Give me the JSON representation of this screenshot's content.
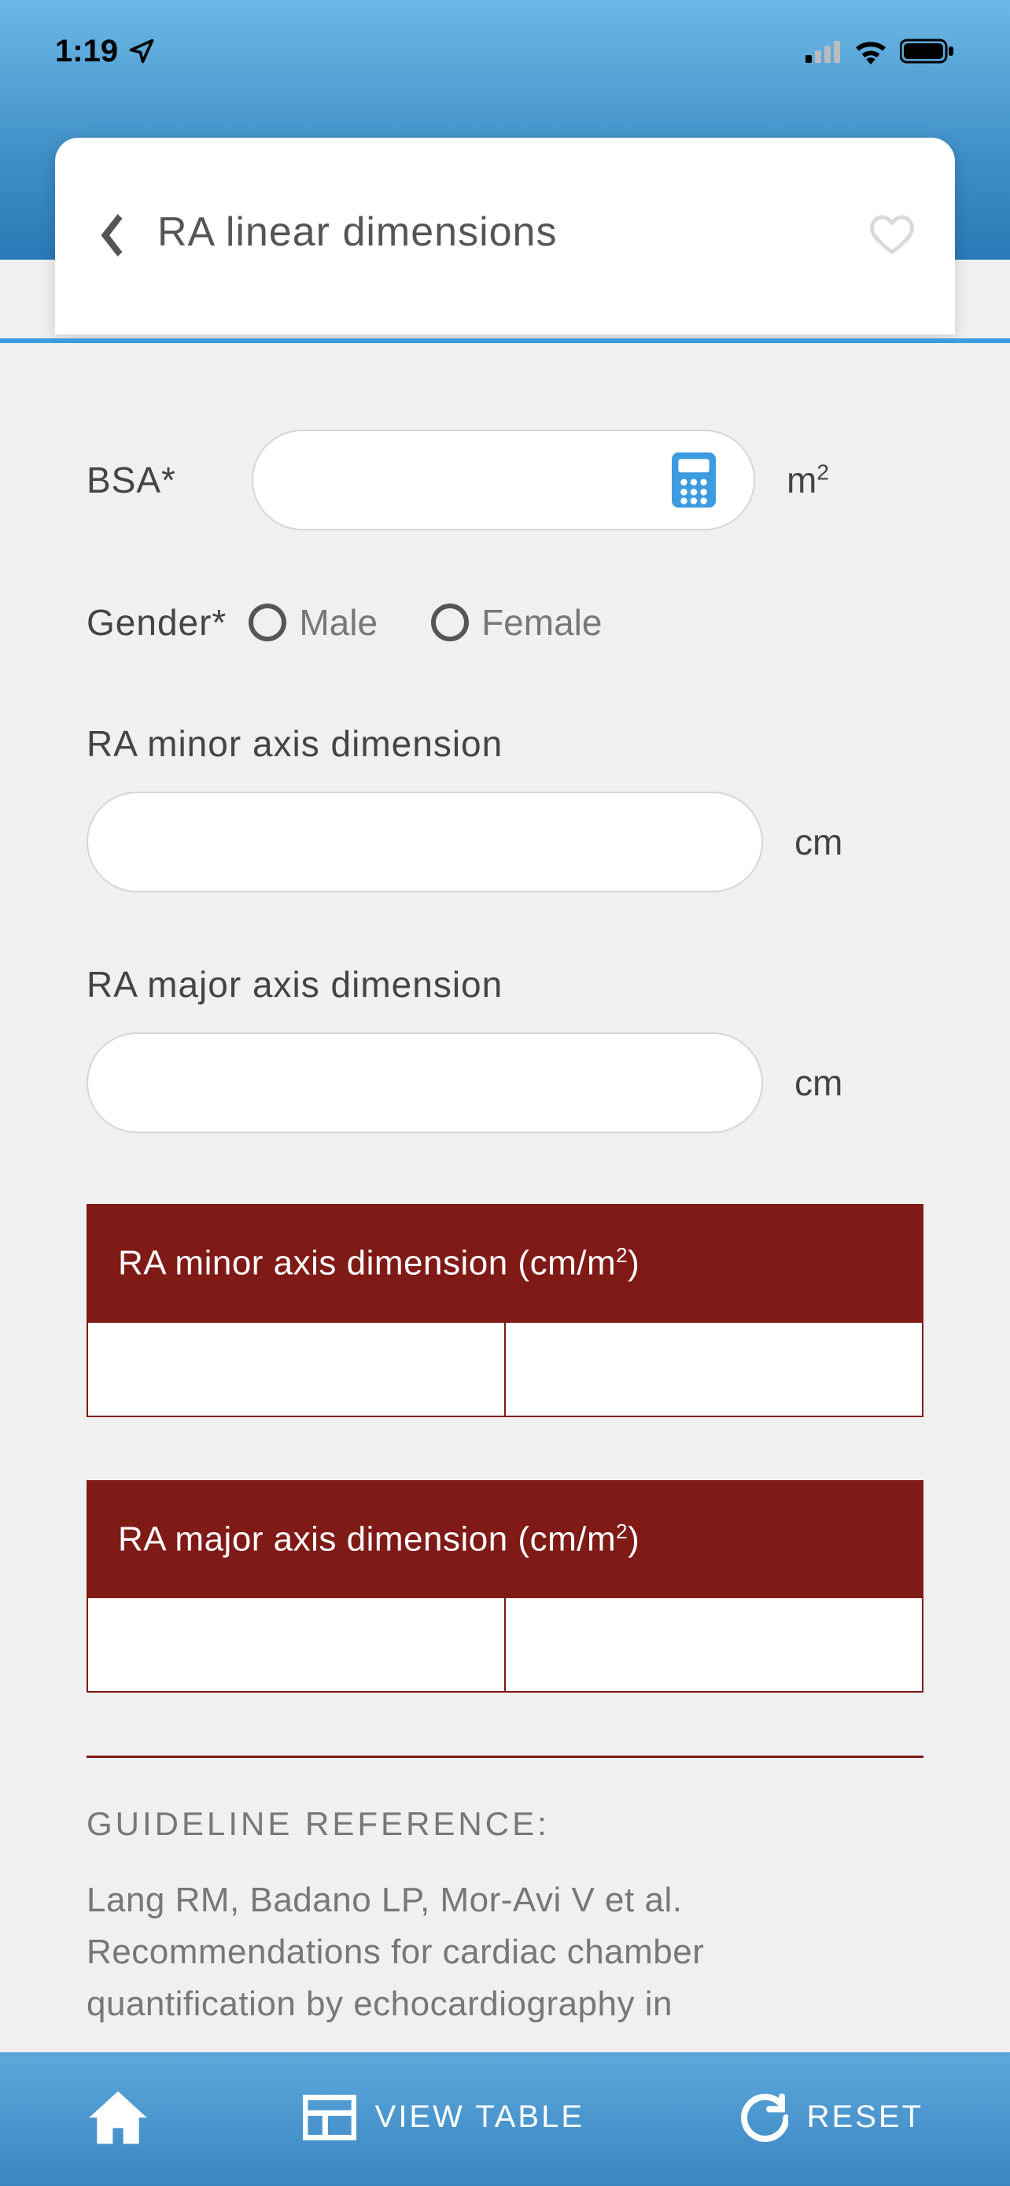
{
  "status": {
    "time": "1:19"
  },
  "header": {
    "title": "RA linear dimensions"
  },
  "form": {
    "bsa_label": "BSA*",
    "bsa_value": "",
    "bsa_unit_base": "m",
    "bsa_unit_exp": "2",
    "gender_label": "Gender*",
    "gender_option_male": "Male",
    "gender_option_female": "Female",
    "ra_minor_label": "RA minor axis dimension",
    "ra_minor_value": "",
    "ra_minor_unit": "cm",
    "ra_major_label": "RA major axis dimension",
    "ra_major_value": "",
    "ra_major_unit": "cm"
  },
  "results": {
    "minor_head_a": "RA minor axis dimension (cm/m",
    "minor_head_exp": "2",
    "minor_head_b": ")",
    "minor_cell_1": "",
    "minor_cell_2": "",
    "major_head_a": "RA major axis dimension (cm/m",
    "major_head_exp": "2",
    "major_head_b": ")",
    "major_cell_1": "",
    "major_cell_2": ""
  },
  "reference": {
    "heading": "GUIDELINE REFERENCE:",
    "text": "Lang RM, Badano LP, Mor-Avi V et al. Recommendations for cardiac chamber quantification by echocardiography in"
  },
  "bottombar": {
    "view_table": "VIEW TABLE",
    "reset": "RESET"
  }
}
